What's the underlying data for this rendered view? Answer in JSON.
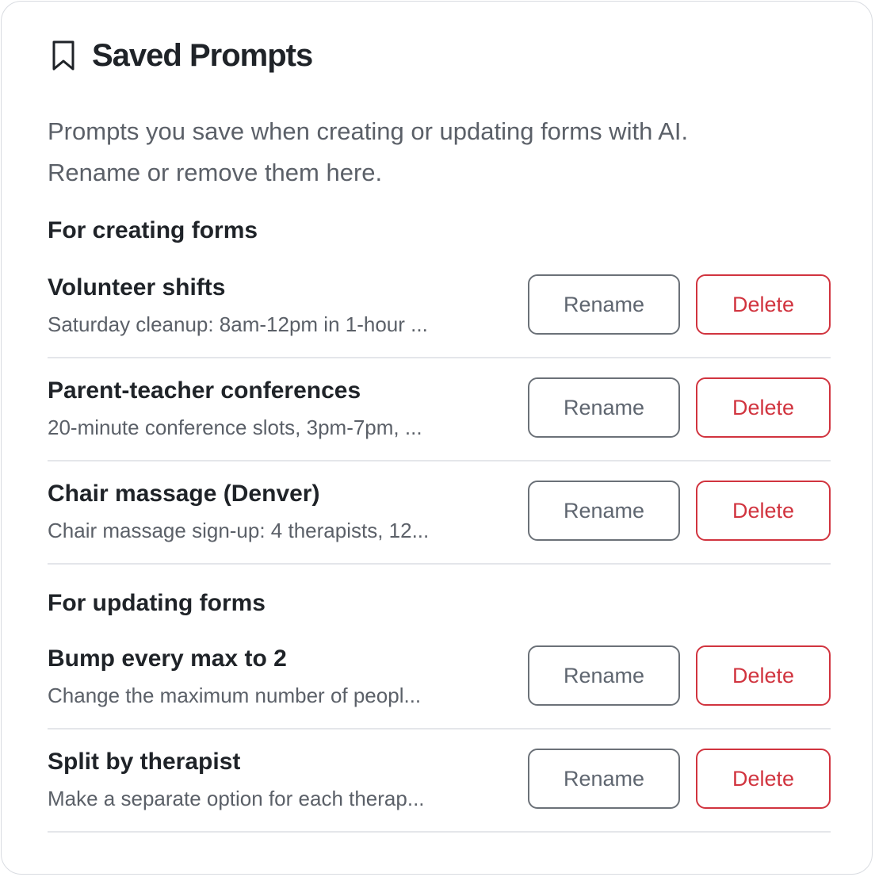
{
  "header": {
    "title": "Saved Prompts",
    "icon": "bookmark-icon"
  },
  "description": {
    "line1": "Prompts you save when creating or updating forms with AI.",
    "line2": "Rename or remove them here."
  },
  "colors": {
    "text": "#1f2328",
    "muted": "#5b6068",
    "danger": "#d1343f",
    "border": "#d9dce1"
  },
  "buttons": {
    "rename_label": "Rename",
    "delete_label": "Delete"
  },
  "sections": [
    {
      "title": "For creating forms",
      "items": [
        {
          "name": "Volunteer shifts",
          "preview": "Saturday cleanup: 8am-12pm in 1-hour ..."
        },
        {
          "name": "Parent-teacher conferences",
          "preview": "20-minute conference slots, 3pm-7pm, ..."
        },
        {
          "name": "Chair massage (Denver)",
          "preview": "Chair massage sign-up: 4 therapists, 12..."
        }
      ]
    },
    {
      "title": "For updating forms",
      "items": [
        {
          "name": "Bump every max to 2",
          "preview": "Change the maximum number of peopl..."
        },
        {
          "name": "Split by therapist",
          "preview": "Make a separate option for each therap..."
        }
      ]
    }
  ]
}
